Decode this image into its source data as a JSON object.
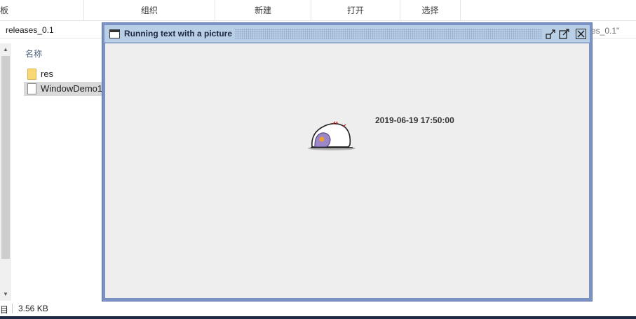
{
  "ribbon": {
    "groups": [
      "板",
      "组织",
      "新建",
      "打开",
      "选择"
    ]
  },
  "address": {
    "path": "releases_0.1",
    "search_placeholder_fragment": "es_0.1\""
  },
  "file_list": {
    "column_name": "名称",
    "items": [
      {
        "name": "res",
        "type": "folder-icon"
      },
      {
        "name": "WindowDemo1",
        "type": "document-icon"
      }
    ]
  },
  "status": {
    "items_fragment": "项目",
    "size": "3.56 KB"
  },
  "java_window": {
    "title": "Running text with a picture",
    "timestamp": "2019-06-19 17:50:00",
    "icons": [
      "window-icon",
      "minimize-icon",
      "maximize-icon",
      "close-icon"
    ]
  }
}
